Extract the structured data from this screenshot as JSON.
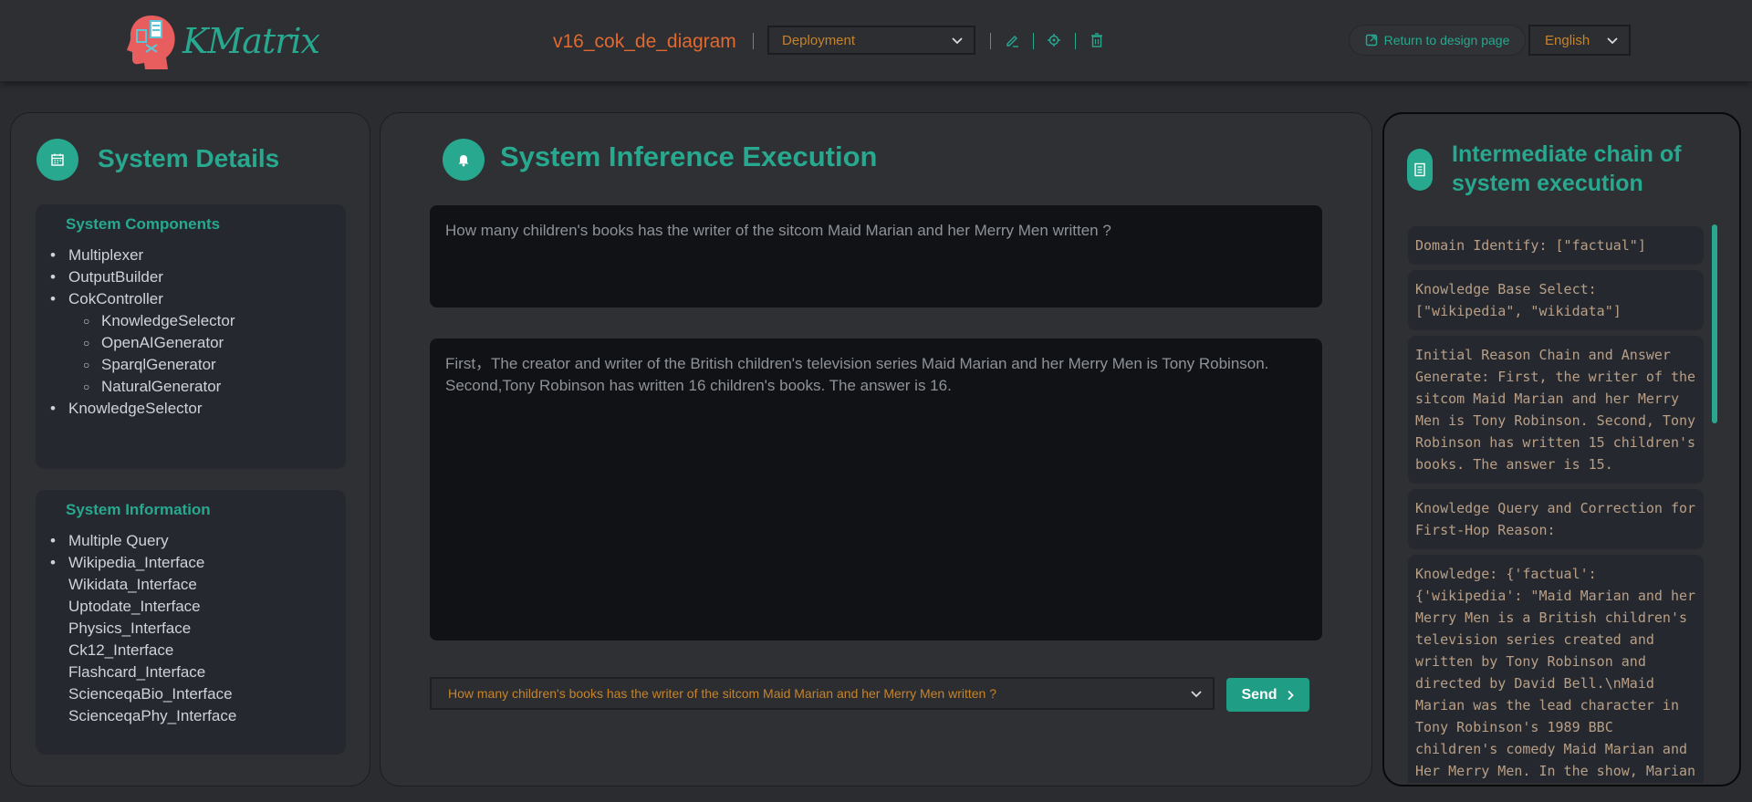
{
  "header": {
    "logo_text": "KMatrix",
    "project_name": "v16_cok_de_diagram",
    "mode_select": "Deployment",
    "return_label": "Return to design page",
    "language": "English",
    "accent_color": "#27a88f",
    "orange_color": "#e0692f"
  },
  "left": {
    "title": "System Details",
    "components": {
      "title": "System Components",
      "items": [
        {
          "label": "Multiplexer",
          "level": 1
        },
        {
          "label": "OutputBuilder",
          "level": 1
        },
        {
          "label": "CokController",
          "level": 1
        },
        {
          "label": "KnowledgeSelector",
          "level": 2
        },
        {
          "label": "OpenAIGenerator",
          "level": 2
        },
        {
          "label": "SparqlGenerator",
          "level": 2
        },
        {
          "label": "NaturalGenerator",
          "level": 2
        },
        {
          "label": "KnowledgeSelector",
          "level": 1
        }
      ]
    },
    "information": {
      "title": "System Information",
      "items": [
        {
          "label": "Multiple Query",
          "bullet": true
        },
        {
          "label": "Wikipedia_Interface",
          "bullet": true
        },
        {
          "label": "Wikidata_Interface",
          "bullet": false
        },
        {
          "label": "Uptodate_Interface",
          "bullet": false
        },
        {
          "label": "Physics_Interface",
          "bullet": false
        },
        {
          "label": "Ck12_Interface",
          "bullet": false
        },
        {
          "label": "Flashcard_Interface",
          "bullet": false
        },
        {
          "label": "ScienceqaBio_Interface",
          "bullet": false
        },
        {
          "label": "ScienceqaPhy_Interface",
          "bullet": false
        }
      ]
    }
  },
  "middle": {
    "title": "System Inference Execution",
    "question": "How many children's books has the writer of the sitcom Maid Marian and her Merry Men written ?",
    "answer": "First，The creator and writer of the British children's television series Maid Marian and her Merry Men is Tony Robinson. Second,Tony Robinson has written 16 children's books. The answer is 16.",
    "select_question": "How many children's books has the writer of the sitcom Maid Marian and her Merry Men written ?",
    "send_label": "Send"
  },
  "right": {
    "title": "Intermediate chain of system execution",
    "chain": [
      "Domain Identify: [\"factual\"]",
      "Knowledge Base Select: [\"wikipedia\", \"wikidata\"]",
      "Initial Reason Chain and Answer Generate: First, the writer of the sitcom Maid Marian and her Merry Men is Tony Robinson. Second, Tony Robinson has written 15 children's books. The answer is 15.",
      "Knowledge Query and Correction for First-Hop Reason:",
      "Knowledge: {'factual': {'wikipedia': \"Maid Marian and her Merry Men is a British children's television series created and written by Tony Robinson and directed by David Bell.\\nMaid Marian was the lead character in Tony Robinson's 1989 BBC children's comedy Maid Marian and Her Merry Men. In the show, Marian (played by Kate Lonergan)"
    ]
  }
}
